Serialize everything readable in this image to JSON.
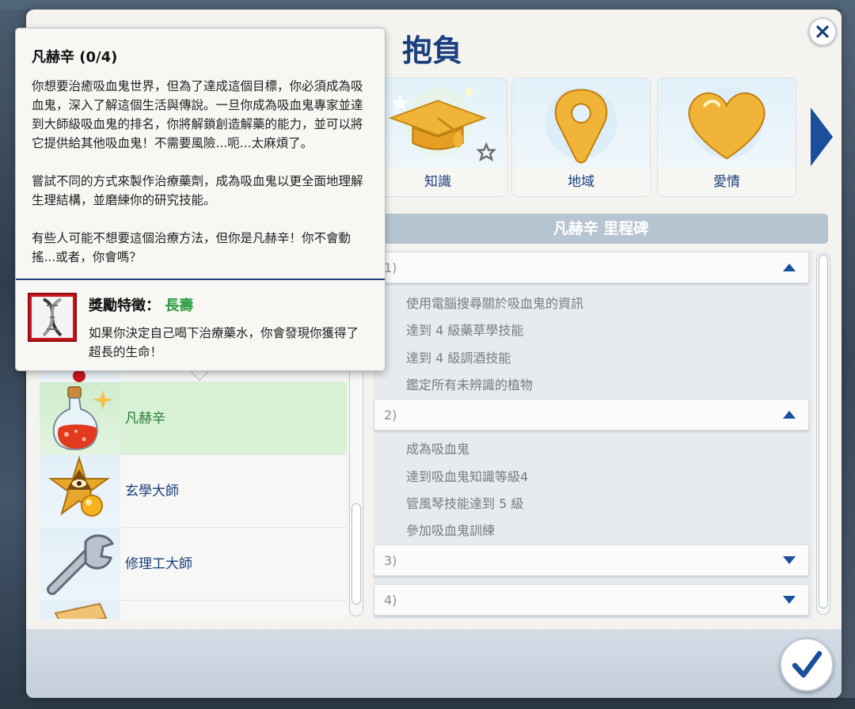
{
  "window": {
    "title": "抱負"
  },
  "categories": [
    {
      "label": "知識",
      "icon": "graduation-cap-icon",
      "selected": true
    },
    {
      "label": "地域",
      "icon": "map-pin-icon",
      "selected": false
    },
    {
      "label": "愛情",
      "icon": "heart-icon",
      "selected": false
    }
  ],
  "milestones": {
    "header": "凡赫辛 里程碑",
    "groups": [
      {
        "label": "1)",
        "expanded": true,
        "tasks": [
          "使用電腦搜尋關於吸血鬼的資訊",
          "達到 4 級藥草學技能",
          "達到 4 級調酒技能",
          "鑑定所有未辨識的植物"
        ]
      },
      {
        "label": "2)",
        "expanded": true,
        "tasks": [
          "成為吸血鬼",
          "達到吸血鬼知識等級4",
          "管風琴技能達到 5 級",
          "參加吸血鬼訓練"
        ]
      },
      {
        "label": "3)",
        "expanded": false,
        "tasks": []
      },
      {
        "label": "4)",
        "expanded": false,
        "tasks": []
      }
    ]
  },
  "aspiration_list": [
    {
      "label": "凡赫辛",
      "icon": "potion-icon",
      "selected": true
    },
    {
      "label": "玄學大師",
      "icon": "occult-eye-icon",
      "selected": false
    },
    {
      "label": "修理工大師",
      "icon": "wrench-icon",
      "selected": false
    }
  ],
  "tooltip": {
    "title": "凡赫辛 (0/4)",
    "paragraphs": [
      "你想要治癒吸血鬼世界，但為了達成這個目標，你必須成為吸血鬼，深入了解這個生活與傳說。一旦你成為吸血鬼專家並達到大師級吸血鬼的排名，你將解鎖創造解藥的能力，並可以將它提供給其他吸血鬼！不需要風險...呃...太麻煩了。",
      "嘗試不同的方式來製作治療藥劑，成為吸血鬼以更全面地理解生理結構，並磨練你的研究技能。",
      "有些人可能不想要這個治療方法，但你是凡赫辛！你不會動搖...或者，你會嗎？"
    ],
    "reward_label": "獎勵特徵：",
    "reward_value": "長壽",
    "reward_desc": "如果你決定自己喝下治療藥水，你會發現你獲得了超長的生命！",
    "reward_icon": "dna-icon"
  },
  "colors": {
    "title_blue": "#1b3f7d",
    "selected_green": "#3db35a",
    "reward_green": "#2ea043",
    "header_grey_blue": "#b7c4d2"
  }
}
